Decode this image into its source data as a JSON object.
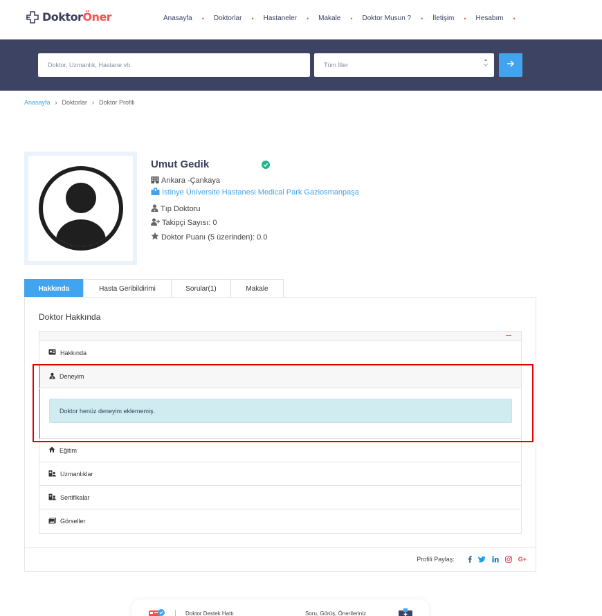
{
  "header": {
    "logo_part1": "Doktor",
    "logo_part2": "Öner",
    "nav": [
      "Anasayfa",
      "Doktorlar",
      "Hastaneler",
      "Makale",
      "Doktor Musun ?",
      "İletişim",
      "Hesabım"
    ]
  },
  "search": {
    "placeholder": "Doktor, Uzmanlık, Hastane vb.",
    "city_select": "Tüm İller"
  },
  "breadcrumb": {
    "home": "Anasayfa",
    "doctors": "Doktorlar",
    "current": "Doktor Profili"
  },
  "profile": {
    "name": "Umut Gedik",
    "location": "Ankara -Çankaya",
    "hospital": "İstinye Üniversite Hastanesi Medical Park Gaziosmanpaşa",
    "specialty": "Tıp Doktoru",
    "followers": "Takipçi Sayısı: 0",
    "rating": "Doktor Puanı (5 üzerinden): 0.0"
  },
  "tabs": [
    "Hakkında",
    "Hasta Geribildirimi",
    "Sorular(1)",
    "Makale"
  ],
  "about": {
    "title": "Doktor Hakkında",
    "sections": [
      "Hakkında",
      "Deneyim",
      "Eğitim",
      "Uzmanlıklar",
      "Sertifikalar",
      "Görseller"
    ],
    "experience_empty": "Doktor henüz deneyim eklememiş.",
    "share_label": "Profili Paylaş:"
  },
  "footer": {
    "support_line": "Doktor Destek Hattı",
    "feedback": "Soru, Görüş, Önerileriniz"
  },
  "colors": {
    "primary": "#42a4ee",
    "navy": "#3d4463",
    "accent": "#f0544f",
    "verified": "#1fb88a",
    "alert_bg": "#d1ecf1",
    "highlight": "#e00000"
  }
}
